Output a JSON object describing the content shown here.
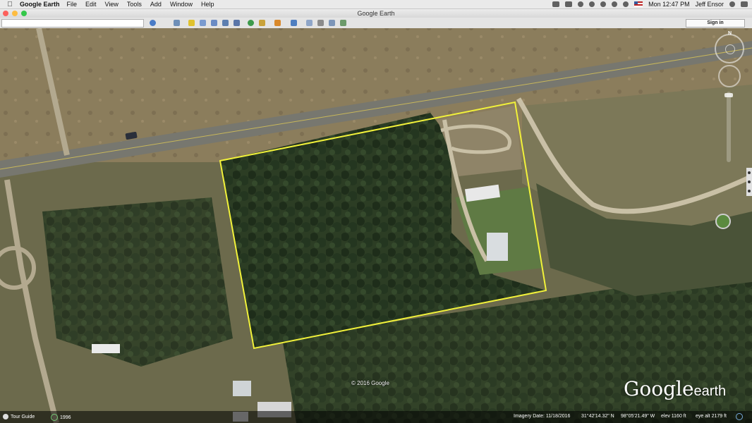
{
  "menubar": {
    "app_name": "Google Earth",
    "items": [
      "File",
      "Edit",
      "View",
      "Tools",
      "Add",
      "Window",
      "Help"
    ],
    "clock": "Mon 12:47 PM",
    "user": "Jeff Ensor"
  },
  "window": {
    "title": "Google Earth"
  },
  "toolbar": {
    "sign_in": "Sign in",
    "search_value": "",
    "icons": [
      "search-icon",
      "sidebar-toggle-icon",
      "placemark-icon",
      "polygon-icon",
      "path-icon",
      "image-overlay-icon",
      "record-tour-icon",
      "historical-imagery-icon",
      "sun-icon",
      "planets-icon",
      "ruler-icon",
      "email-icon",
      "print-icon",
      "save-image-icon",
      "maps-icon"
    ]
  },
  "map": {
    "copyright": "© 2016 Google",
    "logo_main": "Google",
    "logo_sub": "earth",
    "north_label": "N",
    "boundary_color": "#f2f23a"
  },
  "statusbar": {
    "tour_guide": "Tour Guide",
    "history_year": "1996",
    "imagery_date": "Imagery Date: 11/18/2016",
    "lat": "31°42'14.32\" N",
    "lon": "98°05'21.49\" W",
    "elev": "elev  1160 ft",
    "eye_alt": "eye alt  2179 ft"
  }
}
